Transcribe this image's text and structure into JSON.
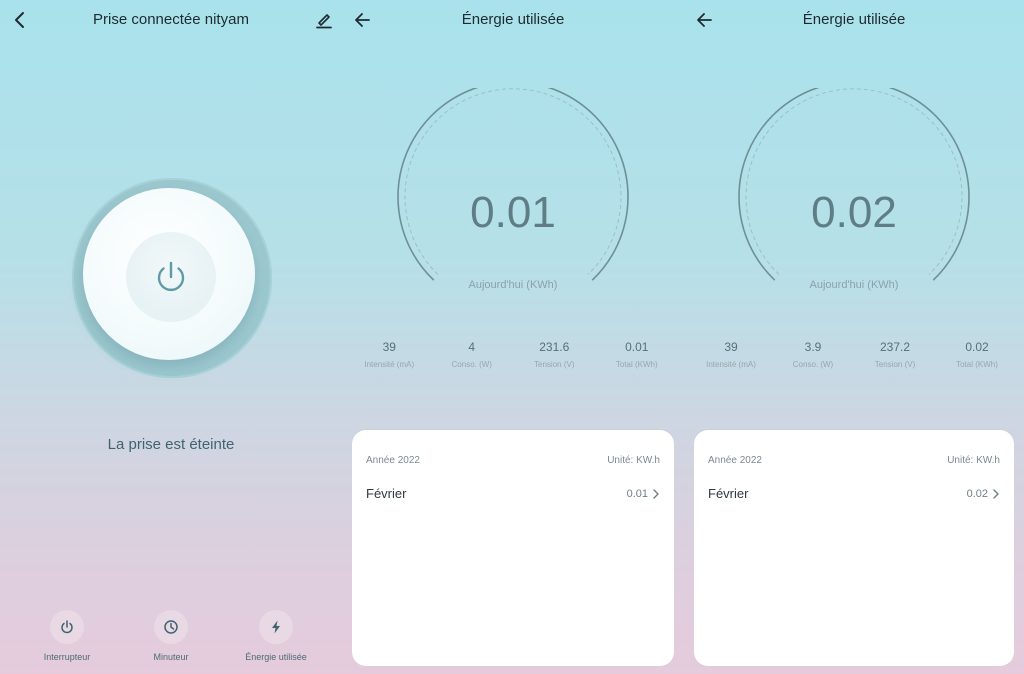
{
  "colors": {
    "accent_teal": "#5f9aa6",
    "gauge_stroke": "#6f8f97",
    "text_dark": "#1f2a30"
  },
  "screen_switch": {
    "title": "Prise connectée nityam",
    "back_icon": "chevron-left-icon",
    "edit_icon": "pencil-icon",
    "power_icon": "power-icon",
    "status": "La prise est éteinte",
    "nav": [
      {
        "label": "Interrupteur",
        "icon": "power-icon"
      },
      {
        "label": "Minuteur",
        "icon": "timer-icon"
      },
      {
        "label": "Énergie utilisée",
        "icon": "lightning-icon"
      }
    ]
  },
  "screen_energy_1": {
    "title": "Énergie utilisée",
    "gauge_value": "0.01",
    "gauge_label": "Aujourd'hui (KWh)",
    "stats": [
      {
        "value": "39",
        "label": "Intensité (mA)"
      },
      {
        "value": "4",
        "label": "Conso. (W)"
      },
      {
        "value": "231.6",
        "label": "Tension (V)"
      },
      {
        "value": "0.01",
        "label": "Total (KWh)"
      }
    ],
    "card": {
      "year": "Année 2022",
      "unit": "Unité: KW.h",
      "rows": [
        {
          "month": "Février",
          "value": "0.01"
        }
      ]
    }
  },
  "screen_energy_2": {
    "title": "Énergie utilisée",
    "gauge_value": "0.02",
    "gauge_label": "Aujourd'hui (KWh)",
    "stats": [
      {
        "value": "39",
        "label": "Intensité (mA)"
      },
      {
        "value": "3.9",
        "label": "Conso. (W)"
      },
      {
        "value": "237.2",
        "label": "Tension (V)"
      },
      {
        "value": "0.02",
        "label": "Total (KWh)"
      }
    ],
    "card": {
      "year": "Année 2022",
      "unit": "Unité: KW.h",
      "rows": [
        {
          "month": "Février",
          "value": "0.02"
        }
      ]
    }
  }
}
